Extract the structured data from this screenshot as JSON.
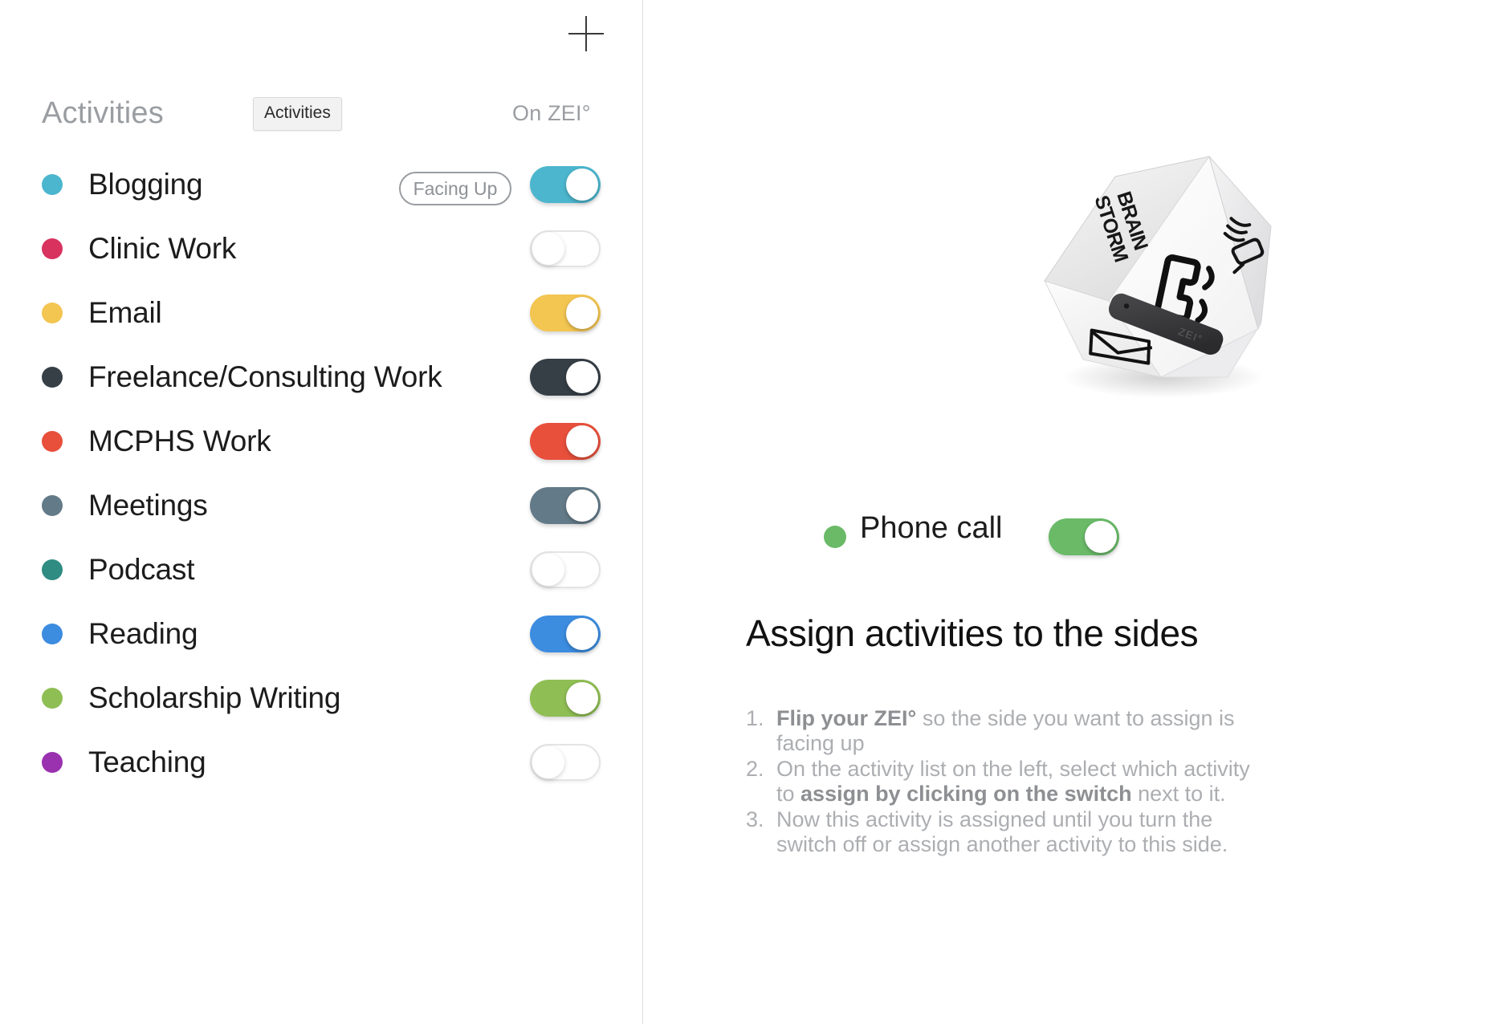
{
  "left": {
    "add_button_label": "+",
    "header": {
      "title": "Activities",
      "right_label": "On ZEI°"
    },
    "tooltip": "Activities",
    "facing_up_badge": "Facing Up",
    "activities": [
      {
        "label": "Blogging",
        "color": "#4cb6ce",
        "on": true,
        "facing_up": true
      },
      {
        "label": "Clinic Work",
        "color": "#d8325f",
        "on": false,
        "facing_up": false
      },
      {
        "label": "Email",
        "color": "#f3c551",
        "on": true,
        "facing_up": false
      },
      {
        "label": "Freelance/Consulting Work",
        "color": "#363e46",
        "on": true,
        "facing_up": false
      },
      {
        "label": "MCPHS Work",
        "color": "#e8503c",
        "on": true,
        "facing_up": false
      },
      {
        "label": "Meetings",
        "color": "#637a88",
        "on": true,
        "facing_up": false
      },
      {
        "label": "Podcast",
        "color": "#2f8c82",
        "on": false,
        "facing_up": false
      },
      {
        "label": "Reading",
        "color": "#3c8ce0",
        "on": true,
        "facing_up": false
      },
      {
        "label": "Scholarship Writing",
        "color": "#8fbe54",
        "on": true,
        "facing_up": false
      },
      {
        "label": "Teaching",
        "color": "#9a32b0",
        "on": false,
        "facing_up": false
      }
    ]
  },
  "right": {
    "device": {
      "brand_label": "ZEI°",
      "side_texts": [
        "BRAIN",
        "STORM"
      ],
      "icons": [
        "phone-handset-icon",
        "writing-hand-icon",
        "envelope-icon"
      ]
    },
    "selected_side": {
      "label": "Phone call",
      "color": "#6aba68",
      "switch_color": "#6aba68",
      "on": true
    },
    "heading": "Assign activities to the sides",
    "steps": [
      {
        "bold_prefix": "Flip your ZEI°",
        "text": " so the side you want to assign is facing up"
      },
      {
        "pre": "On the activity list on the left, select which activity to ",
        "bold": "assign by clicking on the switch",
        "post": " next to it."
      },
      {
        "text": "Now this activity is assigned until you turn the switch off or assign another activity to this side."
      }
    ]
  }
}
